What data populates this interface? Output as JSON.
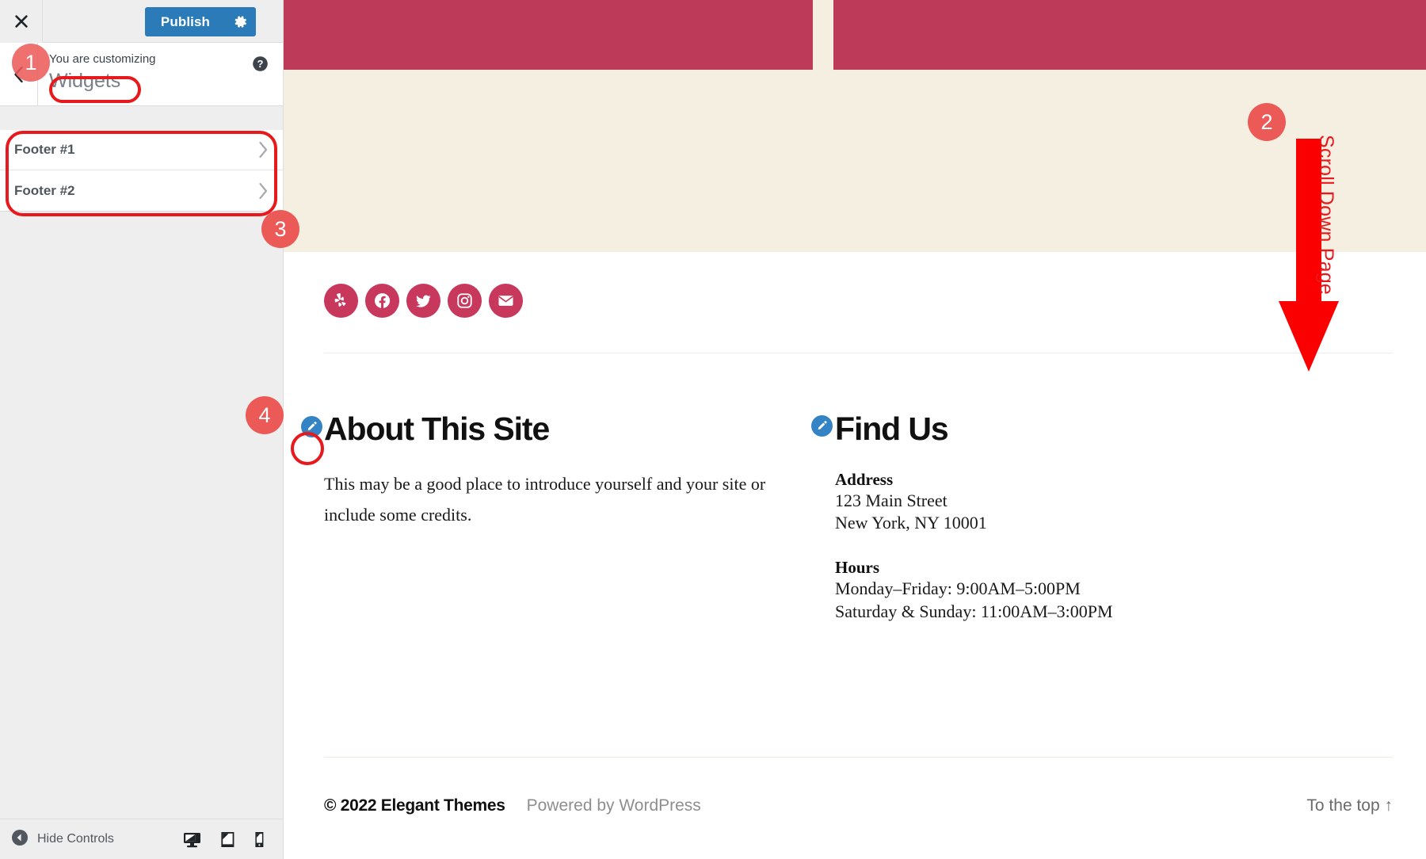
{
  "sidebar": {
    "close_icon": "close-icon",
    "publish_label": "Publish",
    "gear_icon": "gear-icon",
    "back_icon": "chevron-left-icon",
    "customizing_label": "You are customizing",
    "panel_title": "Widgets",
    "help_icon": "help-icon",
    "widgets": [
      {
        "label": "Footer #1",
        "chevron": "chevron-right-icon"
      },
      {
        "label": "Footer #2",
        "chevron": "chevron-right-icon"
      }
    ],
    "footer": {
      "hide_controls_label": "Hide Controls",
      "hide_controls_icon": "collapse-arrow-icon",
      "devices": [
        {
          "name": "desktop-preview",
          "icon": "desktop-icon"
        },
        {
          "name": "tablet-preview",
          "icon": "tablet-icon"
        },
        {
          "name": "mobile-preview",
          "icon": "mobile-icon"
        }
      ]
    }
  },
  "preview": {
    "social": [
      {
        "name": "yelp",
        "icon": "yelp-icon"
      },
      {
        "name": "facebook",
        "icon": "facebook-icon"
      },
      {
        "name": "twitter",
        "icon": "twitter-icon"
      },
      {
        "name": "instagram",
        "icon": "instagram-icon"
      },
      {
        "name": "email",
        "icon": "email-icon"
      }
    ],
    "about": {
      "edit_icon": "edit-pencil-icon",
      "heading": "About This Site",
      "body": "This may be a good place to introduce yourself and your site or include some credits."
    },
    "find": {
      "edit_icon": "edit-pencil-icon",
      "heading": "Find Us",
      "address_title": "Address",
      "address_line1": "123 Main Street",
      "address_line2": "New York, NY 10001",
      "hours_title": "Hours",
      "hours_line1": "Monday–Friday: 9:00AM–5:00PM",
      "hours_line2": "Saturday & Sunday: 11:00AM–3:00PM"
    },
    "footer": {
      "copyright": "© 2022 Elegant Themes",
      "powered_by": "Powered by WordPress",
      "to_the_top": "To the top ↑"
    }
  },
  "annotations": {
    "badges": [
      "1",
      "2",
      "3",
      "4"
    ],
    "scroll_text": "Scroll Down Page",
    "arrow_icon": "down-arrow-annotation"
  },
  "colors": {
    "publish_blue": "#2b7bb9",
    "crimson": "#bd3a58",
    "cream": "#f5efe2",
    "social_pink": "#c8385c",
    "annotation_red": "#e8191c",
    "badge_red": "#ec5a58",
    "pencil_blue": "#3383c5"
  }
}
